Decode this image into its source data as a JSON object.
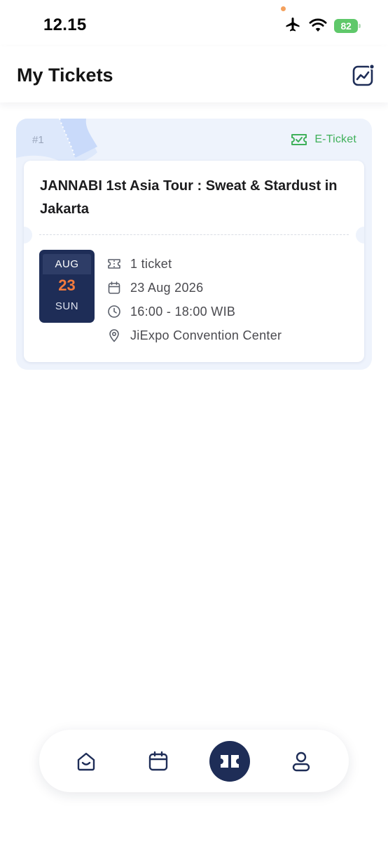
{
  "status_bar": {
    "time": "12.15",
    "battery_level": "82",
    "icons": [
      "airplane-icon",
      "wifi-icon",
      "battery-icon"
    ]
  },
  "header": {
    "title": "My Tickets",
    "action_icon": "chart-icon"
  },
  "tickets": [
    {
      "number": "#1",
      "type_label": "E-Ticket",
      "title": "JANNABI 1st Asia Tour : Sweat & Stardust in Jakarta",
      "date_badge": {
        "month": "AUG",
        "day": "23",
        "weekday": "SUN"
      },
      "details": {
        "quantity": "1 ticket",
        "date": "23 Aug 2026",
        "time": "16:00 - 18:00 WIB",
        "venue": "JiExpo Convention Center"
      }
    }
  ],
  "bottom_nav": {
    "items": [
      {
        "id": "home",
        "icon": "home-icon",
        "active": false
      },
      {
        "id": "calendar",
        "icon": "calendar-icon",
        "active": false
      },
      {
        "id": "tickets",
        "icon": "ticket-icon",
        "active": true
      },
      {
        "id": "profile",
        "icon": "profile-icon",
        "active": false
      }
    ]
  },
  "colors": {
    "primary_navy": "#1e2d57",
    "accent_orange": "#f27a3d",
    "eticket_green": "#3fb05a",
    "card_bg": "#eef3fc",
    "battery_green": "#5fc86a"
  }
}
